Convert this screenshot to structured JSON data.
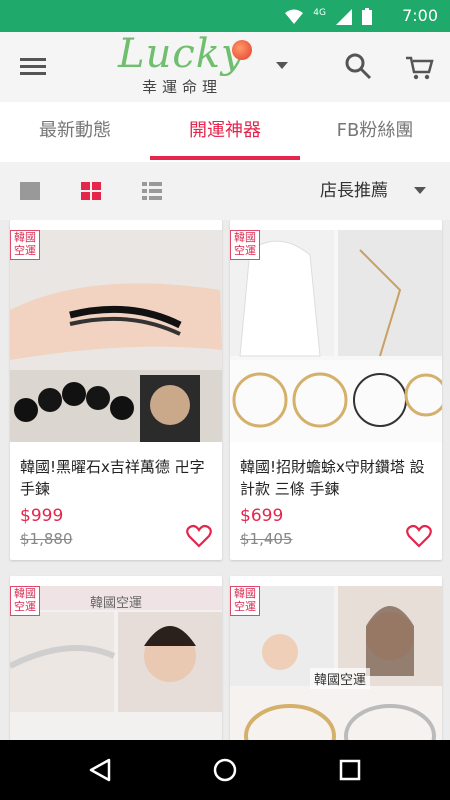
{
  "status_bar": {
    "time": "7:00",
    "network": "4G",
    "icons": [
      "wifi-icon",
      "signal-icon",
      "battery-icon"
    ]
  },
  "app_bar": {
    "logo_text": "Lucky",
    "logo_subtitle": "幸運命理",
    "icons": [
      "menu-icon",
      "chevron-down-icon",
      "search-icon",
      "cart-icon"
    ]
  },
  "tabs": [
    {
      "label": "最新動態",
      "active": false
    },
    {
      "label": "開運神器",
      "active": true
    },
    {
      "label": "FB粉絲團",
      "active": false
    }
  ],
  "toolbar": {
    "view_modes": [
      "single-view-icon",
      "grid-view-icon",
      "list-view-icon"
    ],
    "active_view": "grid-view-icon",
    "sort_label": "店長推薦"
  },
  "products": [
    {
      "badge": "韓國空運",
      "title": "韓國!黑曜石x吉祥萬德 卍字 手鍊",
      "price": "$999",
      "original_price": "$1,880"
    },
    {
      "badge": "韓國空運",
      "title": "韓國!招財蟾蜍x守財鑽塔 設計款 三條 手鍊",
      "price": "$699",
      "original_price": "$1,405"
    },
    {
      "badge": "韓國空運",
      "title": "",
      "price": "",
      "original_price": ""
    },
    {
      "badge": "韓國空運",
      "title": "",
      "price": "",
      "original_price": ""
    }
  ],
  "image_overlays": {
    "p3_banner": "韓國空運",
    "p4_banner": "韓國空運"
  },
  "colors": {
    "status_bar": "#1faa6b",
    "accent": "#e5254c",
    "logo_green": "#6fbf6f"
  },
  "nav_bar": {
    "icons": [
      "back-icon",
      "home-icon",
      "recents-icon"
    ]
  }
}
